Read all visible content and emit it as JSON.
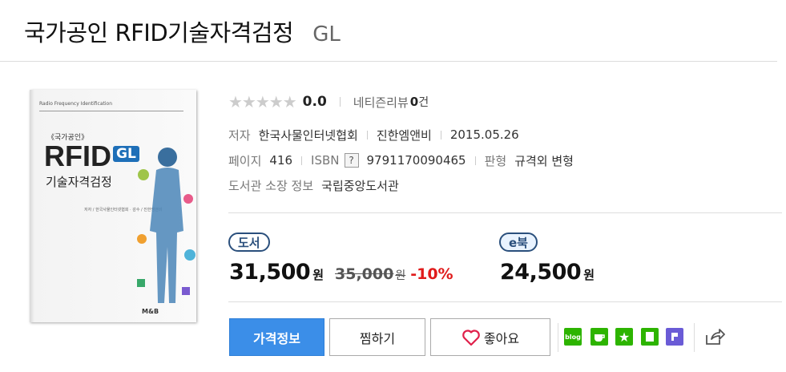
{
  "header": {
    "title": "국가공인 RFID기술자격검정",
    "series": "GL"
  },
  "cover": {
    "top_text": "Radio Frequency Identification",
    "small_title": "《국가공인》",
    "big_title": "RFID",
    "badge": "GL",
    "subtitle": "기술자격검정",
    "authors": "저자 / 한국사물인터넷협회 · 감수 / 진한엠앤비",
    "publisher": "M&B"
  },
  "rating": {
    "stars": "★★★★★",
    "score": "0.0",
    "review_label": "네티즌리뷰",
    "review_count": "0",
    "review_unit": "건"
  },
  "meta": {
    "author_label": "저자",
    "author": "한국사물인터넷협회",
    "publisher": "진한엠앤비",
    "date": "2015.05.26",
    "pages_label": "페이지",
    "pages": "416",
    "isbn_label": "ISBN",
    "isbn_help": "?",
    "isbn": "9791170090465",
    "format_label": "판형",
    "format": "규격외 변형",
    "library_label": "도서관 소장 정보",
    "library": "국립중앙도서관"
  },
  "prices": {
    "book_badge": "도서",
    "book_price": "31,500",
    "won": "원",
    "original_price": "35,000",
    "discount": "-10%",
    "ebook_badge": "e북",
    "ebook_price": "24,500"
  },
  "actions": {
    "price_info": "가격정보",
    "wishlist": "찜하기",
    "like": "좋아요"
  },
  "share": {
    "blog_label": "blog",
    "icons": [
      "blog-icon",
      "cafe-icon",
      "star-icon",
      "note-icon",
      "pinterest-style-icon",
      "share-icon"
    ],
    "colors": {
      "blog": "#2db400",
      "cafe": "#2db400",
      "star": "#2db400",
      "note": "#2db400",
      "p": "#6a5bd6"
    }
  }
}
